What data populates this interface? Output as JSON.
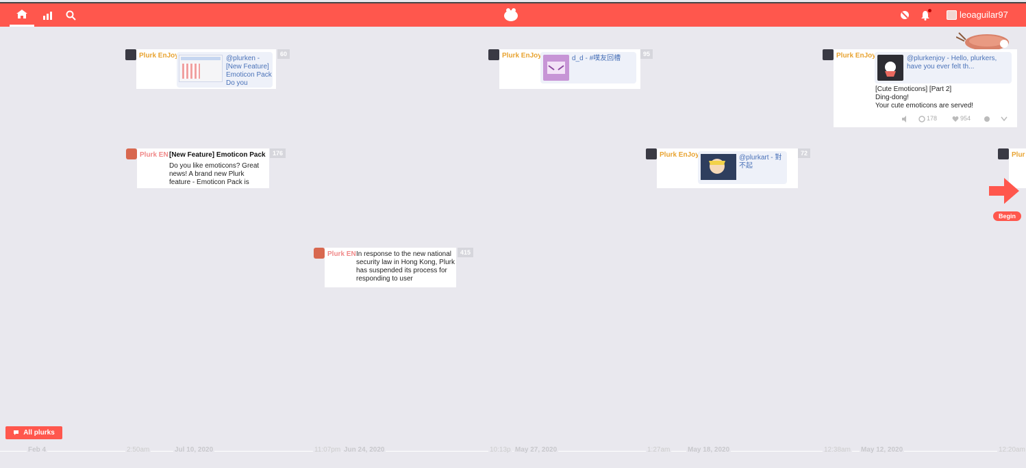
{
  "topbar": {
    "user": "leoaguilar97"
  },
  "plurks": [
    {
      "author": "Plurk EnJoy",
      "count": "60",
      "link": "@plurken - [New Feature] Emoticon Pack Do you"
    },
    {
      "author": "Plurk EnJoy",
      "count": "95",
      "link": "d_d - #噗友回槽"
    },
    {
      "author": "Plurk EnJoy",
      "link": "@plurkenjoy - Hello, plurkers, have you ever felt th...",
      "text1": "[Cute Emoticons] [Part 2]",
      "text2": "Ding-dong!",
      "text3": "Your cute emoticons are served!",
      "replurks": "178",
      "likes": "954"
    },
    {
      "author": "Plurk EN",
      "title": "[New Feature] Emoticon Pack",
      "count": "176",
      "text": "Do you like emoticons? Great news! A brand new Plurk feature - Emoticon Pack is"
    },
    {
      "author": "Plurk EnJoy",
      "count": "72",
      "link": "@plurkart - 對不起"
    },
    {
      "author": "Plurk EN",
      "count": "415",
      "text": "In response to the new national security law in Hong Kong, Plurk has suspended its process for responding to user"
    },
    {
      "author": "Plur"
    }
  ],
  "begin_label": "Begin",
  "all_plurks_label": "All plurks",
  "timeline": {
    "ticks": [
      "Feb 4",
      "2:50am",
      "Jul 10, 2020",
      "11:07pm",
      "Jun 24, 2020",
      "10:13p",
      "May 27, 2020",
      "1:27am",
      "May 18, 2020",
      "12:38am",
      "May 12, 2020",
      "12:20am"
    ]
  },
  "colors": {
    "brand": "#ff574d",
    "background": "#e9e8ee",
    "link": "#4a72b8"
  }
}
